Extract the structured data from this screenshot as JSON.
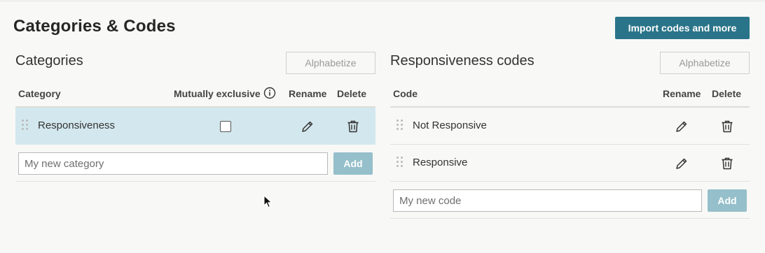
{
  "page": {
    "title": "Categories & Codes",
    "import_button": "Import codes and more"
  },
  "categories_panel": {
    "title": "Categories",
    "alphabetize_button": "Alphabetize",
    "columns": {
      "category": "Category",
      "mutually_exclusive": "Mutually exclusive",
      "rename": "Rename",
      "delete": "Delete"
    },
    "rows": [
      {
        "label": "Responsiveness",
        "mutually_exclusive": false,
        "selected": true
      }
    ],
    "new_input_placeholder": "My new category",
    "add_button": "Add"
  },
  "codes_panel": {
    "title": "Responsiveness codes",
    "alphabetize_button": "Alphabetize",
    "columns": {
      "code": "Code",
      "rename": "Rename",
      "delete": "Delete"
    },
    "rows": [
      {
        "label": "Not Responsive"
      },
      {
        "label": "Responsive"
      }
    ],
    "new_input_placeholder": "My new code",
    "add_button": "Add"
  },
  "colors": {
    "primary": "#2a7489",
    "add_disabled": "#95bfca",
    "selected_row": "#d3e8ee"
  },
  "icons": {
    "rename": "pencil-icon",
    "delete": "trash-icon",
    "drag": "drag-handle-icon",
    "info": "info-icon"
  }
}
